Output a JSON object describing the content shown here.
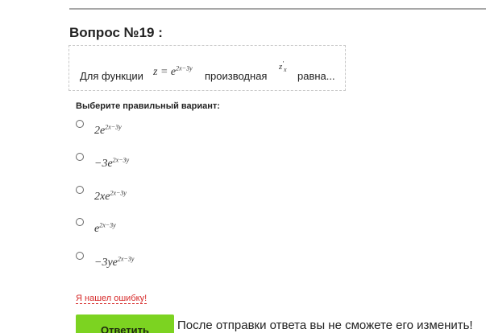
{
  "question": {
    "title": "Вопрос №19 :",
    "text_prefix": "Для функции",
    "function_formula": {
      "lhs": "z",
      "eq": "=",
      "base": "e",
      "exponent": "2x−3y"
    },
    "text_middle": "производная",
    "derivative_formula": {
      "symbol": "z",
      "prime": "′",
      "subscript": "x"
    },
    "text_suffix": "равна..."
  },
  "choose_label": "Выберите правильный вариант:",
  "options": [
    {
      "coef": "2e",
      "exponent": "2x−3y",
      "selected": false
    },
    {
      "coef": "−3e",
      "exponent": "2x−3y",
      "selected": false
    },
    {
      "coef": "2xe",
      "exponent": "2x−3y",
      "selected": false
    },
    {
      "coef": "e",
      "exponent": "2x−3y",
      "selected": false
    },
    {
      "coef": "−3ye",
      "exponent": "2x−3y",
      "selected": false
    }
  ],
  "report_link": "Я нашел ошибку!",
  "submit_label": "Ответить",
  "warning": "После отправки ответа вы не сможете его изменить!",
  "colors": {
    "accent_button": "#7cd321",
    "report_link": "#d72a2a",
    "rule": "#a7a7a7"
  }
}
